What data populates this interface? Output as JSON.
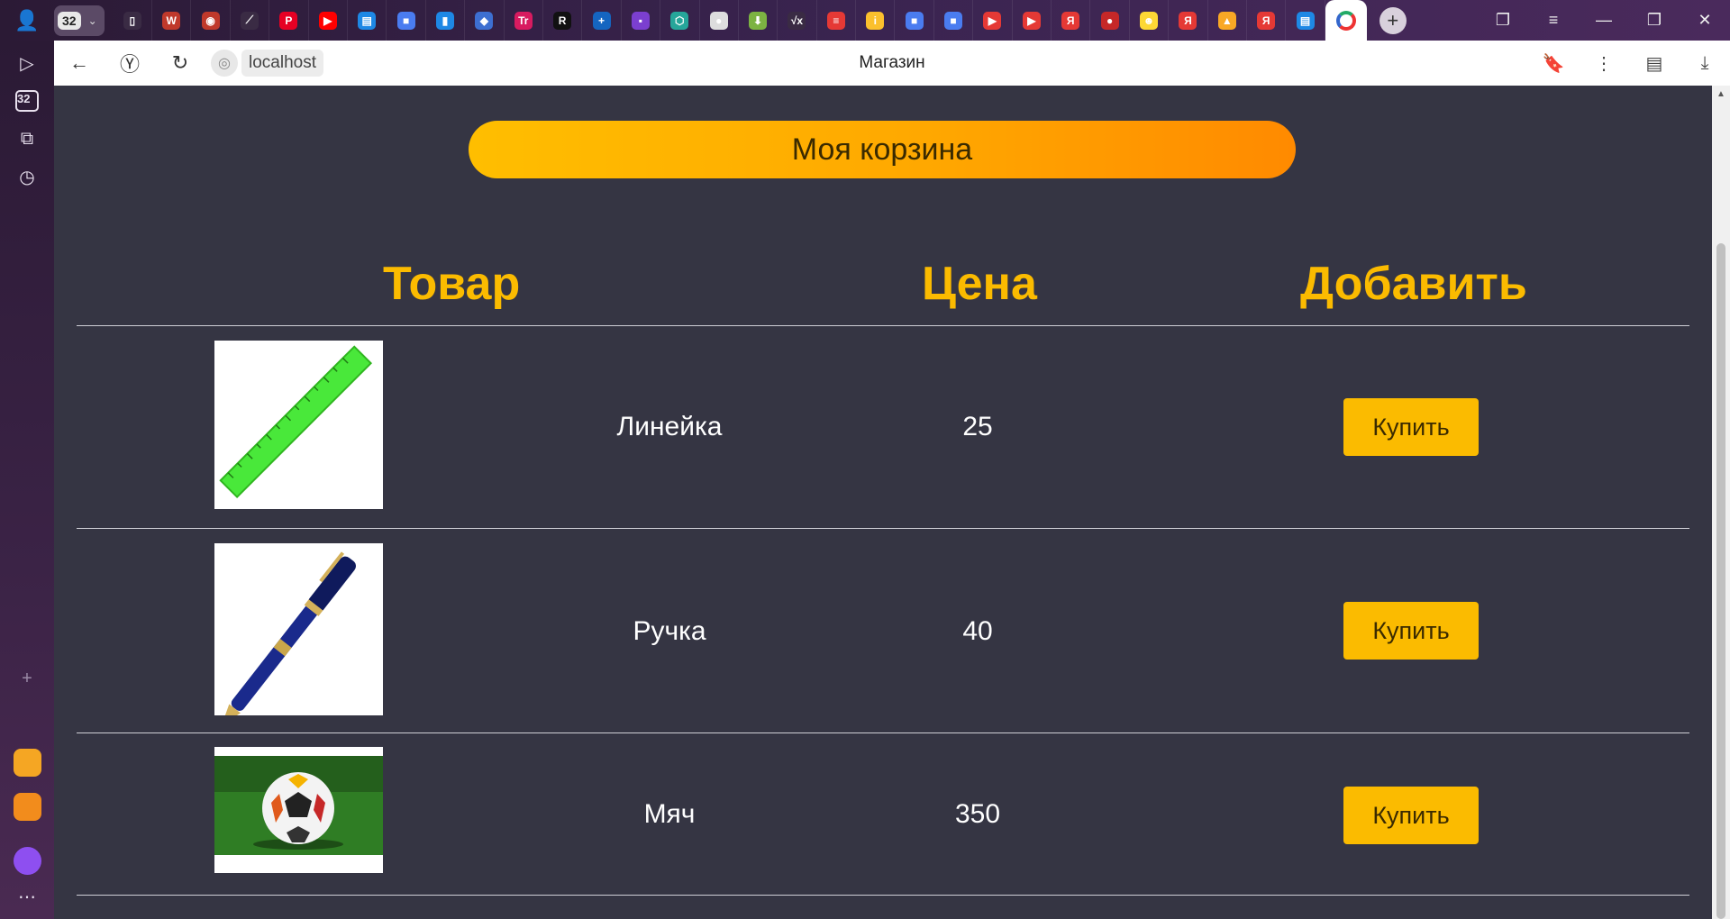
{
  "browser": {
    "tab_count": "32",
    "url_host": "localhost",
    "page_title": "Магазин",
    "tab_icons": [
      {
        "name": "doc",
        "color": "#3a2b44",
        "glyph": "▯"
      },
      {
        "name": "w",
        "color": "#c0392b",
        "glyph": "W"
      },
      {
        "name": "red-circle",
        "color": "#c0392b",
        "glyph": "◉"
      },
      {
        "name": "loader",
        "color": "#3a2b44",
        "glyph": "⟋"
      },
      {
        "name": "pinterest",
        "color": "#e60023",
        "glyph": "P"
      },
      {
        "name": "youtube",
        "color": "#ff0000",
        "glyph": "▶"
      },
      {
        "name": "chat",
        "color": "#1e88e5",
        "glyph": "▤"
      },
      {
        "name": "cube",
        "color": "#4a7cf0",
        "glyph": "■"
      },
      {
        "name": "book",
        "color": "#1e88e5",
        "glyph": "▮"
      },
      {
        "name": "basket",
        "color": "#3d6fd1",
        "glyph": "◆"
      },
      {
        "name": "tr",
        "color": "#d81b60",
        "glyph": "Tr"
      },
      {
        "name": "r",
        "color": "#111",
        "glyph": "R"
      },
      {
        "name": "plus",
        "color": "#1565c0",
        "glyph": "+"
      },
      {
        "name": "purple",
        "color": "#7b3fd0",
        "glyph": "▪"
      },
      {
        "name": "box",
        "color": "#26a69a",
        "glyph": "⬡"
      },
      {
        "name": "circle",
        "color": "#ddd",
        "glyph": "●"
      },
      {
        "name": "download",
        "color": "#7cb342",
        "glyph": "⬇"
      },
      {
        "name": "sqrt",
        "color": "#3a2b44",
        "glyph": "√x"
      },
      {
        "name": "stripes",
        "color": "#e53935",
        "glyph": "≡"
      },
      {
        "name": "info",
        "color": "#fbc02d",
        "glyph": "i"
      },
      {
        "name": "cube2",
        "color": "#4a7cf0",
        "glyph": "■"
      },
      {
        "name": "cube3",
        "color": "#4a7cf0",
        "glyph": "■"
      },
      {
        "name": "play1",
        "color": "#e53935",
        "glyph": "▶"
      },
      {
        "name": "play2",
        "color": "#e53935",
        "glyph": "▶"
      },
      {
        "name": "ya1",
        "color": "#e53935",
        "glyph": "Я"
      },
      {
        "name": "red2",
        "color": "#c62828",
        "glyph": "●"
      },
      {
        "name": "face",
        "color": "#fdd835",
        "glyph": "☻"
      },
      {
        "name": "ya2",
        "color": "#e53935",
        "glyph": "Я"
      },
      {
        "name": "picture",
        "color": "#f9a825",
        "glyph": "▲"
      },
      {
        "name": "ya3",
        "color": "#e53935",
        "glyph": "Я"
      },
      {
        "name": "msg",
        "color": "#1e88e5",
        "glyph": "▤"
      }
    ]
  },
  "shop": {
    "cart_label": "Моя корзина",
    "headers": {
      "product": "Товар",
      "price": "Цена",
      "add": "Добавить"
    },
    "products": [
      {
        "name": "Линейка",
        "price": "25",
        "button": "Купить",
        "image": "ruler"
      },
      {
        "name": "Ручка",
        "price": "40",
        "button": "Купить",
        "image": "pen"
      },
      {
        "name": "Мяч",
        "price": "350",
        "button": "Купить",
        "image": "soccer-ball"
      }
    ]
  }
}
